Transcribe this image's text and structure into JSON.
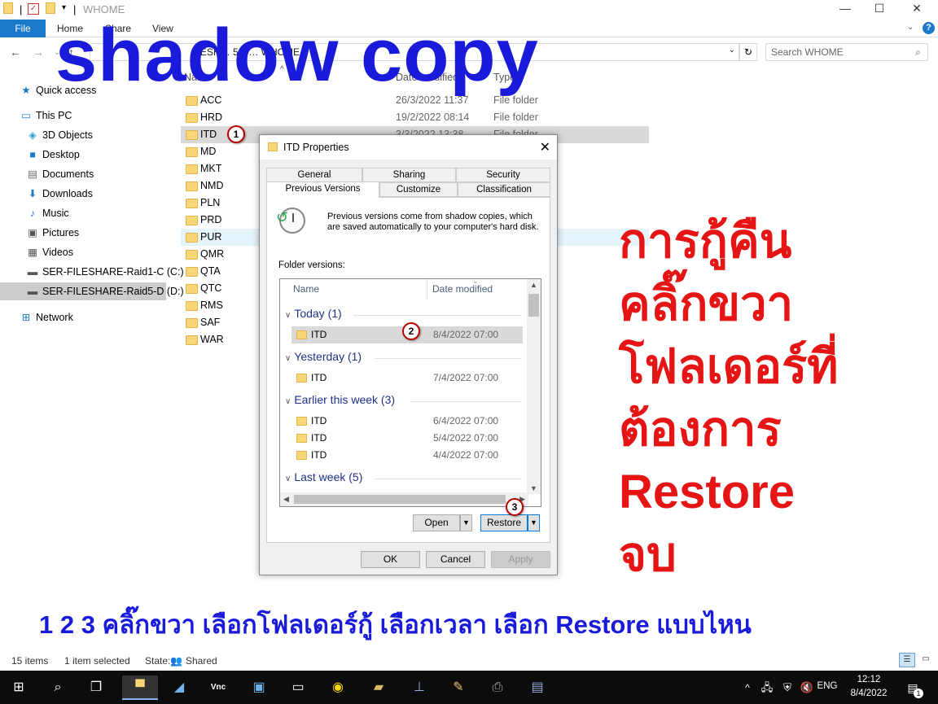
{
  "window": {
    "title": "WHOME",
    "controls": {
      "minimize": "—",
      "maximize": "☐",
      "close": "✕"
    }
  },
  "ribbon": {
    "file": "File",
    "tabs": [
      "Home",
      "Share",
      "View"
    ]
  },
  "address": {
    "path_visible": "ESH… 5-D… WHOME",
    "search_placeholder": "Search WHOME"
  },
  "nav": {
    "quick_access": "Quick access",
    "this_pc": "This PC",
    "items": [
      "3D Objects",
      "Desktop",
      "Documents",
      "Downloads",
      "Music",
      "Pictures",
      "Videos",
      "SER-FILESHARE-Raid1-C (C:)",
      "SER-FILESHARE-Raid5-D (D:)"
    ],
    "network": "Network"
  },
  "filelist": {
    "headers": {
      "name": "Name",
      "date": "Date modified",
      "type": "Type"
    },
    "rows": [
      {
        "name": "ACC",
        "date": "26/3/2022 11:37",
        "type": "File folder"
      },
      {
        "name": "HRD",
        "date": "19/2/2022 08:14",
        "type": "File folder"
      },
      {
        "name": "ITD",
        "date": "3/3/2022 13:38",
        "type": "File folder"
      },
      {
        "name": "MD",
        "date": "",
        "type": ""
      },
      {
        "name": "MKT",
        "date": "",
        "type": ""
      },
      {
        "name": "NMD",
        "date": "",
        "type": ""
      },
      {
        "name": "PLN",
        "date": "",
        "type": ""
      },
      {
        "name": "PRD",
        "date": "",
        "type": ""
      },
      {
        "name": "PUR",
        "date": "",
        "type": ""
      },
      {
        "name": "QMR",
        "date": "",
        "type": ""
      },
      {
        "name": "QTA",
        "date": "",
        "type": ""
      },
      {
        "name": "QTC",
        "date": "",
        "type": ""
      },
      {
        "name": "RMS",
        "date": "",
        "type": ""
      },
      {
        "name": "SAF",
        "date": "",
        "type": ""
      },
      {
        "name": "WAR",
        "date": "",
        "type": ""
      }
    ]
  },
  "dialog": {
    "title": "ITD Properties",
    "tabs_row1": [
      "General",
      "Sharing",
      "Security"
    ],
    "tabs_row2": [
      "Previous Versions",
      "Customize",
      "Classification"
    ],
    "info": "Previous versions come from shadow copies, which are saved automatically to your computer's hard disk.",
    "folder_versions_label": "Folder versions:",
    "list_headers": {
      "name": "Name",
      "date": "Date modified"
    },
    "groups": [
      {
        "label": "Today (1)",
        "items": [
          {
            "name": "ITD",
            "date": "8/4/2022 07:00"
          }
        ]
      },
      {
        "label": "Yesterday (1)",
        "items": [
          {
            "name": "ITD",
            "date": "7/4/2022 07:00"
          }
        ]
      },
      {
        "label": "Earlier this week (3)",
        "items": [
          {
            "name": "ITD",
            "date": "6/4/2022 07:00"
          },
          {
            "name": "ITD",
            "date": "5/4/2022 07:00"
          },
          {
            "name": "ITD",
            "date": "4/4/2022 07:00"
          }
        ]
      },
      {
        "label": "Last week (5)",
        "items": []
      }
    ],
    "buttons": {
      "open": "Open",
      "restore": "Restore",
      "ok": "OK",
      "cancel": "Cancel",
      "apply": "Apply"
    }
  },
  "badges": [
    "1",
    "2",
    "3"
  ],
  "overlay": {
    "title": "shadow copy",
    "thai_lines": [
      "การกู้คืน",
      "คลิ๊กขวา",
      "โฟลเดอร์ที่",
      "ต้องการ",
      "Restore",
      "จบ"
    ],
    "steps": "1 2 3 คลิ๊กขวา เลือกโฟลเดอร์กู้ เลือกเวลา เลือก Restore แบบไหน"
  },
  "status": {
    "items": "15 items",
    "selected": "1 item selected",
    "state_label": "State:",
    "state_value": "Shared"
  },
  "taskbar": {
    "lang": "ENG",
    "time": "12:12",
    "date": "8/4/2022",
    "notif_count": "1"
  },
  "colors": {
    "overlay_blue": "#1a1adb",
    "overlay_red": "#e61515",
    "file_tab": "#1979ca",
    "badge_ring": "#b00000"
  }
}
